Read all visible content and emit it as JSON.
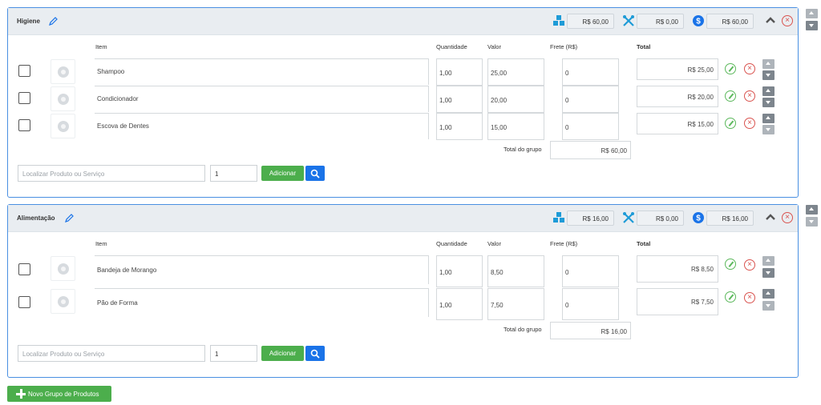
{
  "columns": {
    "item": "Item",
    "quantidade": "Quantidade",
    "valor": "Valor",
    "frete": "Frete (R$)",
    "total": "Total"
  },
  "group_total_label": "Total do grupo",
  "search_placeholder": "Localizar Produto ou Serviço",
  "add_label": "Adicionar",
  "new_group_label": "Novo Grupo de Produtos",
  "groups": [
    {
      "name": "Higiene",
      "products_total": "R$ 60,00",
      "services_total": "R$ 0,00",
      "price_total": "R$ 60,00",
      "group_total": "R$ 60,00",
      "qty_input": "1",
      "rows": [
        {
          "item": "Shampoo",
          "quantidade": "1,00",
          "valor": "25,00",
          "frete": "0",
          "total": "R$ 25,00"
        },
        {
          "item": "Condicionador",
          "quantidade": "1,00",
          "valor": "20,00",
          "frete": "0",
          "total": "R$ 20,00"
        },
        {
          "item": "Escova de Dentes",
          "quantidade": "1,00",
          "valor": "15,00",
          "frete": "0",
          "total": "R$ 15,00"
        }
      ]
    },
    {
      "name": "Alimentação",
      "products_total": "R$ 16,00",
      "services_total": "R$ 0,00",
      "price_total": "R$ 16,00",
      "group_total": "R$ 16,00",
      "qty_input": "1",
      "rows": [
        {
          "item": "Bandeja de Morango",
          "quantidade": "1,00",
          "valor": "8,50",
          "frete": "0",
          "total": "R$ 8,50"
        },
        {
          "item": "Pão de Forma",
          "quantidade": "1,00",
          "valor": "7,50",
          "frete": "0",
          "total": "R$ 7,50"
        }
      ]
    }
  ],
  "icons": {
    "products": "boxes-icon",
    "services": "tools-icon",
    "money": "dollar-circle-icon",
    "collapse": "chevron-up-icon",
    "remove": "close-circle-icon",
    "edit": "pencil-circle-icon",
    "rename": "pencil-icon",
    "image": "camera-placeholder-icon",
    "search": "search-icon",
    "add": "plus-icon"
  },
  "colors": {
    "border": "#4a90e2",
    "header_bg": "#e9edf1",
    "green": "#4cae4c",
    "blue": "#1a73e8",
    "red": "#d9534f",
    "icon_blue": "#1e9bd7"
  }
}
